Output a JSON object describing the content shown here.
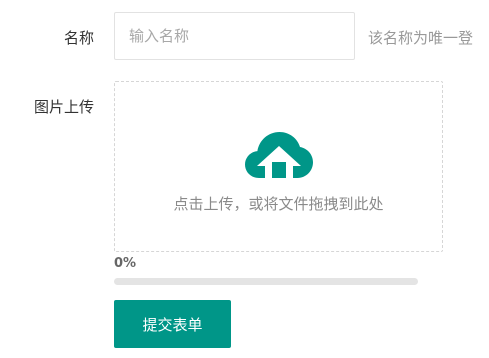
{
  "form": {
    "name_label": "名称",
    "name_placeholder": "输入名称",
    "name_value": "",
    "name_hint": "该名称为唯一登",
    "upload_label": "图片上传",
    "upload_text": "点击上传，或将文件拖拽到此处",
    "upload_icon": "cloud-upload-icon",
    "progress_text": "0%",
    "progress_value": 0,
    "submit_label": "提交表单"
  },
  "colors": {
    "accent": "#009688",
    "track": "#e4e4e4"
  }
}
